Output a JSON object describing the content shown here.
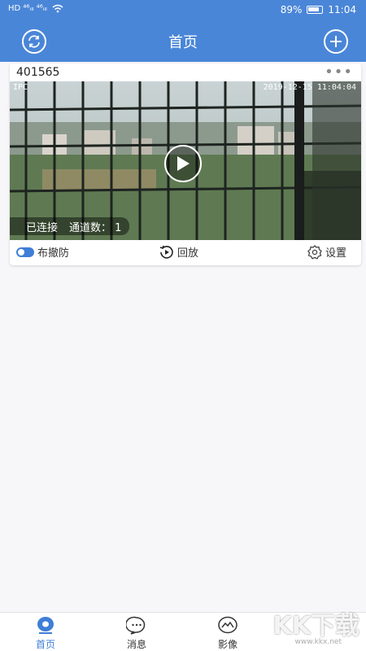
{
  "status_bar": {
    "left_text": "HD ⁴⁶ᵢₗₗ ⁴⁶ᵢₗₗ",
    "battery": "89%",
    "time": "11:04"
  },
  "header": {
    "title": "首页",
    "left_icon": "refresh-icon",
    "right_icon": "plus-icon"
  },
  "device": {
    "name": "401565",
    "more_icon": "ellipsis-icon",
    "osd_label": "IPC",
    "osd_timestamp": "2019-12-15 11:04:04",
    "connection_status": "已连接",
    "channel_count": "通道数： 1",
    "actions": {
      "arm": "布撤防",
      "playback": "回放",
      "settings": "设置"
    }
  },
  "bottom_nav": [
    {
      "label": "首页",
      "icon": "home-icon",
      "active": true
    },
    {
      "label": "消息",
      "icon": "message-icon",
      "active": false
    },
    {
      "label": "影像",
      "icon": "image-icon",
      "active": false
    }
  ],
  "watermark": {
    "brand": "KK下载",
    "url": "www.kkx.net"
  },
  "colors": {
    "accent": "#4a86d8",
    "active": "#3f7ed6"
  }
}
